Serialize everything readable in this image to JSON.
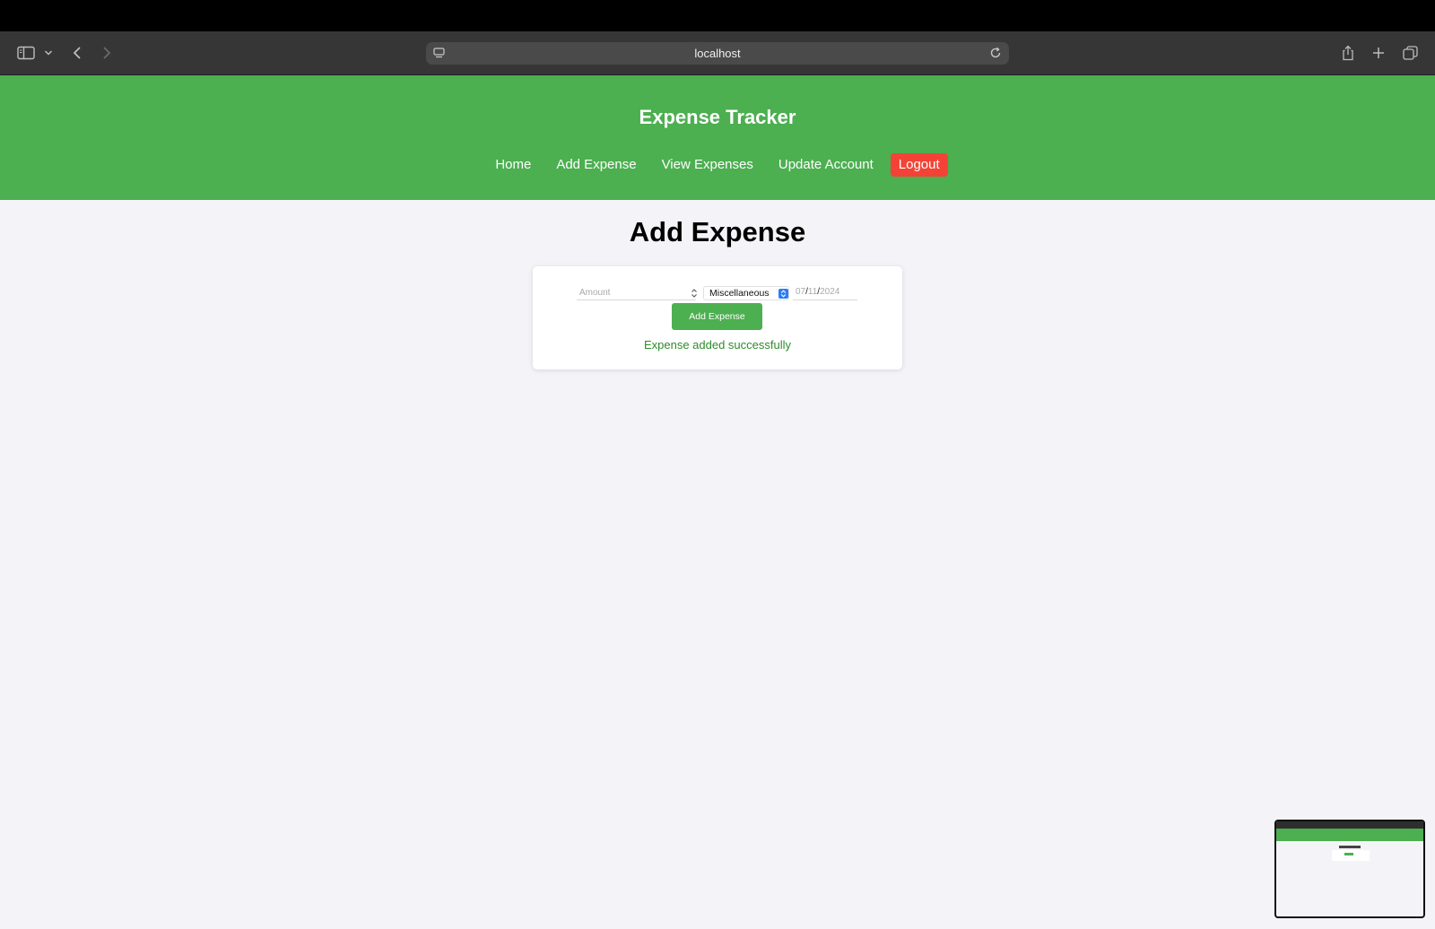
{
  "browser": {
    "url": "localhost",
    "icons": {
      "sidebar": "sidebar-icon",
      "chevron": "chevron-down-icon",
      "back": "back-icon",
      "forward": "forward-icon",
      "reload": "reload-icon",
      "share": "share-icon",
      "new_tab": "plus-icon",
      "tabs": "tabs-overview-icon"
    }
  },
  "header": {
    "title": "Expense Tracker",
    "nav": {
      "home": "Home",
      "add_expense": "Add Expense",
      "view_expenses": "View Expenses",
      "update_account": "Update Account",
      "logout": "Logout"
    },
    "colors": {
      "header_bg": "#4caf50",
      "logout_bg": "#f44336"
    }
  },
  "main": {
    "heading": "Add Expense",
    "form": {
      "amount_placeholder": "Amount",
      "amount_value": "",
      "category_selected": "Miscellaneous",
      "date": {
        "month": "07",
        "day": "11",
        "year": "2024"
      },
      "submit_label": "Add Expense"
    },
    "message": "Expense added successfully"
  }
}
